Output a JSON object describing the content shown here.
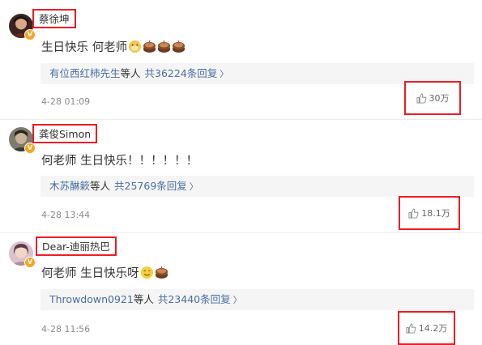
{
  "comments": [
    {
      "username": "蔡徐坤",
      "text": "生日快乐 何老师",
      "emojis": [
        "doge-face-icon",
        "cake-icon",
        "cake-icon",
        "cake-icon"
      ],
      "reply_users": "有位西红柿先生",
      "reply_static": "等人",
      "reply_count": "共36224条回复",
      "reply_chevron": "〉",
      "time": "4-28 01:09",
      "likes": "30万",
      "verified_badge": "V",
      "avatar_color": "#6b3a2e"
    },
    {
      "username": "龚俊Simon",
      "text": "何老师 生日快乐！！！！！！",
      "emojis": [],
      "reply_users": "木苏醂簌",
      "reply_static": "等人",
      "reply_count": "共25769条回复",
      "reply_chevron": "〉",
      "time": "4-28 13:44",
      "likes": "18.1万",
      "verified_badge": "V",
      "avatar_color": "#8a8a7a"
    },
    {
      "username": "Dear-迪丽热巴",
      "text": "何老师 生日快乐呀",
      "emojis": [
        "smile-face-icon",
        "cake-icon"
      ],
      "reply_users": "Throwdown0921",
      "reply_static": "等人",
      "reply_count": "共23440条回复",
      "reply_chevron": "〉",
      "time": "4-28 11:56",
      "likes": "14.2万",
      "verified_badge": "V",
      "avatar_color": "#c9a3b0"
    }
  ],
  "colors": {
    "highlight_border": "#ee1c24",
    "link": "#4a6ea3",
    "reply_bg": "#f5f5f5",
    "badge": "#f5a623"
  }
}
